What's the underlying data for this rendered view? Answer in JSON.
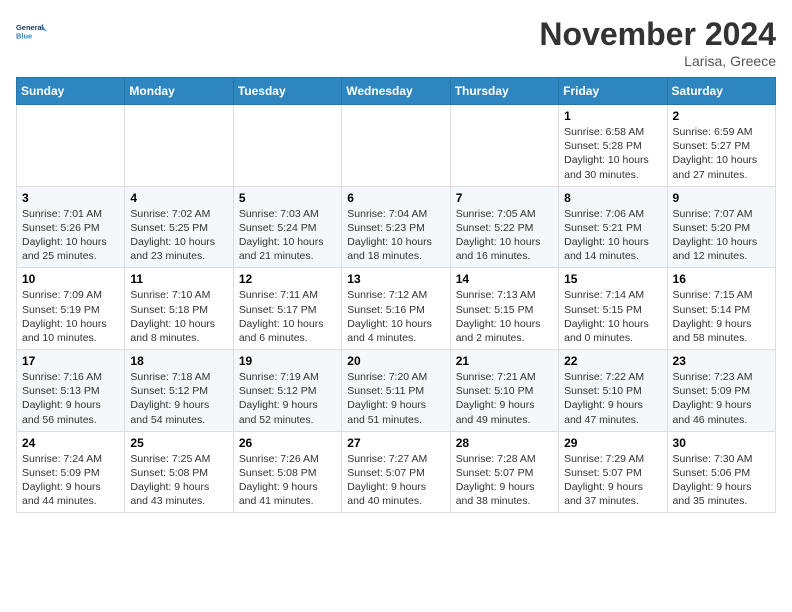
{
  "header": {
    "logo_line1": "General",
    "logo_line2": "Blue",
    "month_title": "November 2024",
    "location": "Larisa, Greece"
  },
  "weekdays": [
    "Sunday",
    "Monday",
    "Tuesday",
    "Wednesday",
    "Thursday",
    "Friday",
    "Saturday"
  ],
  "weeks": [
    [
      {
        "day": "",
        "info": ""
      },
      {
        "day": "",
        "info": ""
      },
      {
        "day": "",
        "info": ""
      },
      {
        "day": "",
        "info": ""
      },
      {
        "day": "",
        "info": ""
      },
      {
        "day": "1",
        "info": "Sunrise: 6:58 AM\nSunset: 5:28 PM\nDaylight: 10 hours\nand 30 minutes."
      },
      {
        "day": "2",
        "info": "Sunrise: 6:59 AM\nSunset: 5:27 PM\nDaylight: 10 hours\nand 27 minutes."
      }
    ],
    [
      {
        "day": "3",
        "info": "Sunrise: 7:01 AM\nSunset: 5:26 PM\nDaylight: 10 hours\nand 25 minutes."
      },
      {
        "day": "4",
        "info": "Sunrise: 7:02 AM\nSunset: 5:25 PM\nDaylight: 10 hours\nand 23 minutes."
      },
      {
        "day": "5",
        "info": "Sunrise: 7:03 AM\nSunset: 5:24 PM\nDaylight: 10 hours\nand 21 minutes."
      },
      {
        "day": "6",
        "info": "Sunrise: 7:04 AM\nSunset: 5:23 PM\nDaylight: 10 hours\nand 18 minutes."
      },
      {
        "day": "7",
        "info": "Sunrise: 7:05 AM\nSunset: 5:22 PM\nDaylight: 10 hours\nand 16 minutes."
      },
      {
        "day": "8",
        "info": "Sunrise: 7:06 AM\nSunset: 5:21 PM\nDaylight: 10 hours\nand 14 minutes."
      },
      {
        "day": "9",
        "info": "Sunrise: 7:07 AM\nSunset: 5:20 PM\nDaylight: 10 hours\nand 12 minutes."
      }
    ],
    [
      {
        "day": "10",
        "info": "Sunrise: 7:09 AM\nSunset: 5:19 PM\nDaylight: 10 hours\nand 10 minutes."
      },
      {
        "day": "11",
        "info": "Sunrise: 7:10 AM\nSunset: 5:18 PM\nDaylight: 10 hours\nand 8 minutes."
      },
      {
        "day": "12",
        "info": "Sunrise: 7:11 AM\nSunset: 5:17 PM\nDaylight: 10 hours\nand 6 minutes."
      },
      {
        "day": "13",
        "info": "Sunrise: 7:12 AM\nSunset: 5:16 PM\nDaylight: 10 hours\nand 4 minutes."
      },
      {
        "day": "14",
        "info": "Sunrise: 7:13 AM\nSunset: 5:15 PM\nDaylight: 10 hours\nand 2 minutes."
      },
      {
        "day": "15",
        "info": "Sunrise: 7:14 AM\nSunset: 5:15 PM\nDaylight: 10 hours\nand 0 minutes."
      },
      {
        "day": "16",
        "info": "Sunrise: 7:15 AM\nSunset: 5:14 PM\nDaylight: 9 hours\nand 58 minutes."
      }
    ],
    [
      {
        "day": "17",
        "info": "Sunrise: 7:16 AM\nSunset: 5:13 PM\nDaylight: 9 hours\nand 56 minutes."
      },
      {
        "day": "18",
        "info": "Sunrise: 7:18 AM\nSunset: 5:12 PM\nDaylight: 9 hours\nand 54 minutes."
      },
      {
        "day": "19",
        "info": "Sunrise: 7:19 AM\nSunset: 5:12 PM\nDaylight: 9 hours\nand 52 minutes."
      },
      {
        "day": "20",
        "info": "Sunrise: 7:20 AM\nSunset: 5:11 PM\nDaylight: 9 hours\nand 51 minutes."
      },
      {
        "day": "21",
        "info": "Sunrise: 7:21 AM\nSunset: 5:10 PM\nDaylight: 9 hours\nand 49 minutes."
      },
      {
        "day": "22",
        "info": "Sunrise: 7:22 AM\nSunset: 5:10 PM\nDaylight: 9 hours\nand 47 minutes."
      },
      {
        "day": "23",
        "info": "Sunrise: 7:23 AM\nSunset: 5:09 PM\nDaylight: 9 hours\nand 46 minutes."
      }
    ],
    [
      {
        "day": "24",
        "info": "Sunrise: 7:24 AM\nSunset: 5:09 PM\nDaylight: 9 hours\nand 44 minutes."
      },
      {
        "day": "25",
        "info": "Sunrise: 7:25 AM\nSunset: 5:08 PM\nDaylight: 9 hours\nand 43 minutes."
      },
      {
        "day": "26",
        "info": "Sunrise: 7:26 AM\nSunset: 5:08 PM\nDaylight: 9 hours\nand 41 minutes."
      },
      {
        "day": "27",
        "info": "Sunrise: 7:27 AM\nSunset: 5:07 PM\nDaylight: 9 hours\nand 40 minutes."
      },
      {
        "day": "28",
        "info": "Sunrise: 7:28 AM\nSunset: 5:07 PM\nDaylight: 9 hours\nand 38 minutes."
      },
      {
        "day": "29",
        "info": "Sunrise: 7:29 AM\nSunset: 5:07 PM\nDaylight: 9 hours\nand 37 minutes."
      },
      {
        "day": "30",
        "info": "Sunrise: 7:30 AM\nSunset: 5:06 PM\nDaylight: 9 hours\nand 35 minutes."
      }
    ]
  ]
}
